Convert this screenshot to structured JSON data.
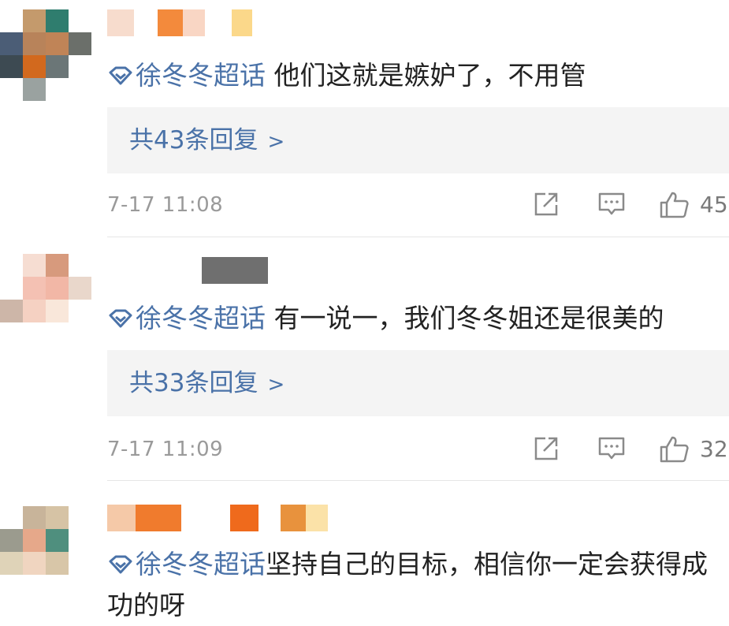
{
  "topic_label": "徐冬冬超话",
  "comments": [
    {
      "text": "他们这就是嫉妒了，不用管",
      "replies_label": "共43条回复",
      "replies_arrow": ">",
      "time": "7-17 11:08",
      "likes": "45"
    },
    {
      "text": "有一说一，我们冬冬姐还是很美的",
      "replies_label": "共33条回复",
      "replies_arrow": ">",
      "time": "7-17 11:09",
      "likes": "32"
    },
    {
      "text": "坚持自己的目标，相信你一定会获得成功的呀"
    }
  ],
  "colors": {
    "link": "#4a72a8",
    "meta": "#9a9a9a",
    "reply_bg": "#f4f4f4"
  },
  "icons": [
    "topic-icon",
    "share-icon",
    "comment-icon",
    "like-icon"
  ]
}
